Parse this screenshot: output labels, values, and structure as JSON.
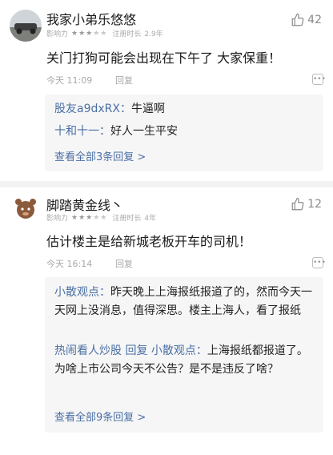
{
  "comments": [
    {
      "username": "我家小弟乐悠悠",
      "meta_label": "影响力",
      "stars": 5,
      "register_label": "注册时长",
      "register_value": "2.9年",
      "likes": "42",
      "text": "关门打狗可能会出现在下午了 大家保重！",
      "time": "今天 11:09",
      "reply_label": "回复",
      "replies": [
        {
          "name": "股友a9dxRX：",
          "text": "牛逼啊"
        },
        {
          "name": "十和十一：",
          "text": "好人一生平安"
        }
      ],
      "view_all": "查看全部3条回复 >"
    },
    {
      "username": "脚踏黄金线丶",
      "meta_label": "影响力",
      "stars": 5,
      "register_label": "注册时长",
      "register_value": "4年",
      "likes": "12",
      "text": "估计楼主是给新城老板开车的司机！",
      "time": "今天 16:14",
      "reply_label": "回复",
      "replies": [
        {
          "name": "小散观点：",
          "text": "昨天晚上上海报纸报道了的，然而今天一天网上没消息，值得深思。楼主上海人，看了报纸"
        },
        {
          "name": "热闹看人炒股 回复 小散观点：",
          "text": "上海报纸都报道了。为啥上市公司今天不公告？是不是违反了啥？"
        }
      ],
      "view_all": "查看全部9条回复 >"
    }
  ]
}
